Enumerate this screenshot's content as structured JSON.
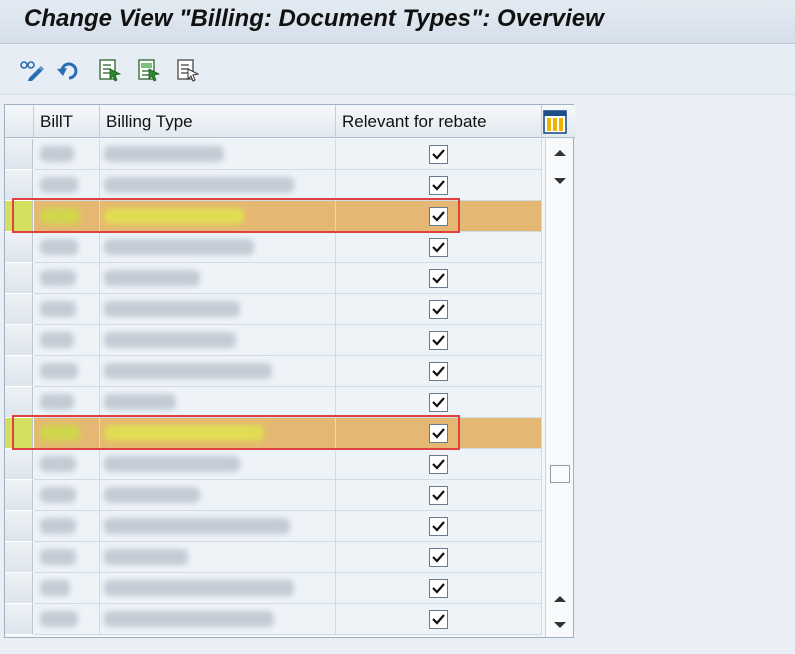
{
  "window": {
    "title": "Change View \"Billing: Document Types\": Overview"
  },
  "toolbar": {
    "buttons": [
      {
        "name": "display-change-icon"
      },
      {
        "name": "undo-icon"
      },
      {
        "name": "select-all-icon"
      },
      {
        "name": "select-block-icon"
      },
      {
        "name": "deselect-all-icon"
      }
    ]
  },
  "table": {
    "columns": {
      "billt": "BillT",
      "billing_type": "Billing Type",
      "rebate": "Relevant for rebate"
    },
    "rows": [
      {
        "relevant_for_rebate": true,
        "highlighted": false
      },
      {
        "relevant_for_rebate": true,
        "highlighted": false
      },
      {
        "relevant_for_rebate": true,
        "highlighted": true
      },
      {
        "relevant_for_rebate": true,
        "highlighted": false
      },
      {
        "relevant_for_rebate": true,
        "highlighted": false
      },
      {
        "relevant_for_rebate": true,
        "highlighted": false
      },
      {
        "relevant_for_rebate": true,
        "highlighted": false
      },
      {
        "relevant_for_rebate": true,
        "highlighted": false
      },
      {
        "relevant_for_rebate": true,
        "highlighted": false
      },
      {
        "relevant_for_rebate": true,
        "highlighted": true
      },
      {
        "relevant_for_rebate": true,
        "highlighted": false
      },
      {
        "relevant_for_rebate": true,
        "highlighted": false
      },
      {
        "relevant_for_rebate": true,
        "highlighted": false
      },
      {
        "relevant_for_rebate": true,
        "highlighted": false
      },
      {
        "relevant_for_rebate": true,
        "highlighted": false
      },
      {
        "relevant_for_rebate": true,
        "highlighted": false
      }
    ]
  },
  "colors": {
    "highlight_row": "#e4b872",
    "highlight_marker": "#e04040",
    "table_bg": "#eef3f8"
  }
}
